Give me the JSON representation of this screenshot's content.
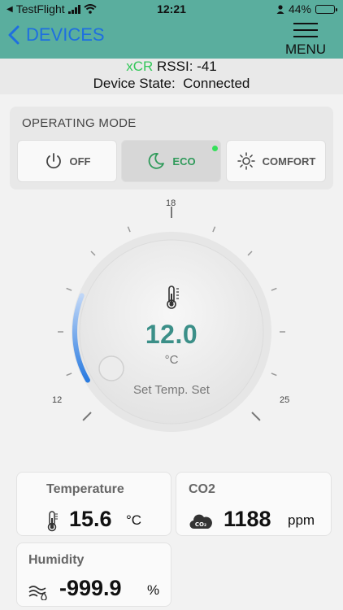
{
  "status_bar": {
    "carrier": "TestFlight",
    "time": "12:21",
    "battery": "44%",
    "battery_level": 0.44
  },
  "nav": {
    "back_label": "DEVICES",
    "menu_label": "MENU"
  },
  "device": {
    "name": "xCR",
    "rssi_label": "RSSI:",
    "rssi_value": "-41",
    "state_label": "Device State:",
    "state_value": "Connected"
  },
  "operating_mode": {
    "title": "OPERATING MODE",
    "buttons": [
      {
        "label": "OFF",
        "icon": "power-icon",
        "active": false
      },
      {
        "label": "ECO",
        "icon": "moon-icon",
        "active": true
      },
      {
        "label": "COMFORT",
        "icon": "sun-icon",
        "active": false
      }
    ]
  },
  "thermostat": {
    "min_label": "12",
    "mid_label": "18",
    "max_label": "25",
    "min": 12,
    "max": 25,
    "value": "12.0",
    "value_number": 12.0,
    "unit": "°C",
    "caption": "Set Temp. Set",
    "icon": "thermometer-icon",
    "accent": "#4a90e2"
  },
  "sensors": {
    "temperature": {
      "title": "Temperature",
      "value": "15.6",
      "unit": "°C",
      "icon": "thermometer-icon"
    },
    "co2": {
      "title": "CO2",
      "value": "1188",
      "unit": "ppm",
      "icon": "co2-cloud-icon",
      "icon_text": "CO₂"
    },
    "humidity": {
      "title": "Humidity",
      "value": "-999.9",
      "unit": "%",
      "icon": "humidity-icon"
    }
  },
  "colors": {
    "header": "#5aae9e",
    "link": "#1e6fe0",
    "active_mode": "#2f9a5a",
    "temp_value": "#3b8f88",
    "indicator": "#35e05a"
  }
}
